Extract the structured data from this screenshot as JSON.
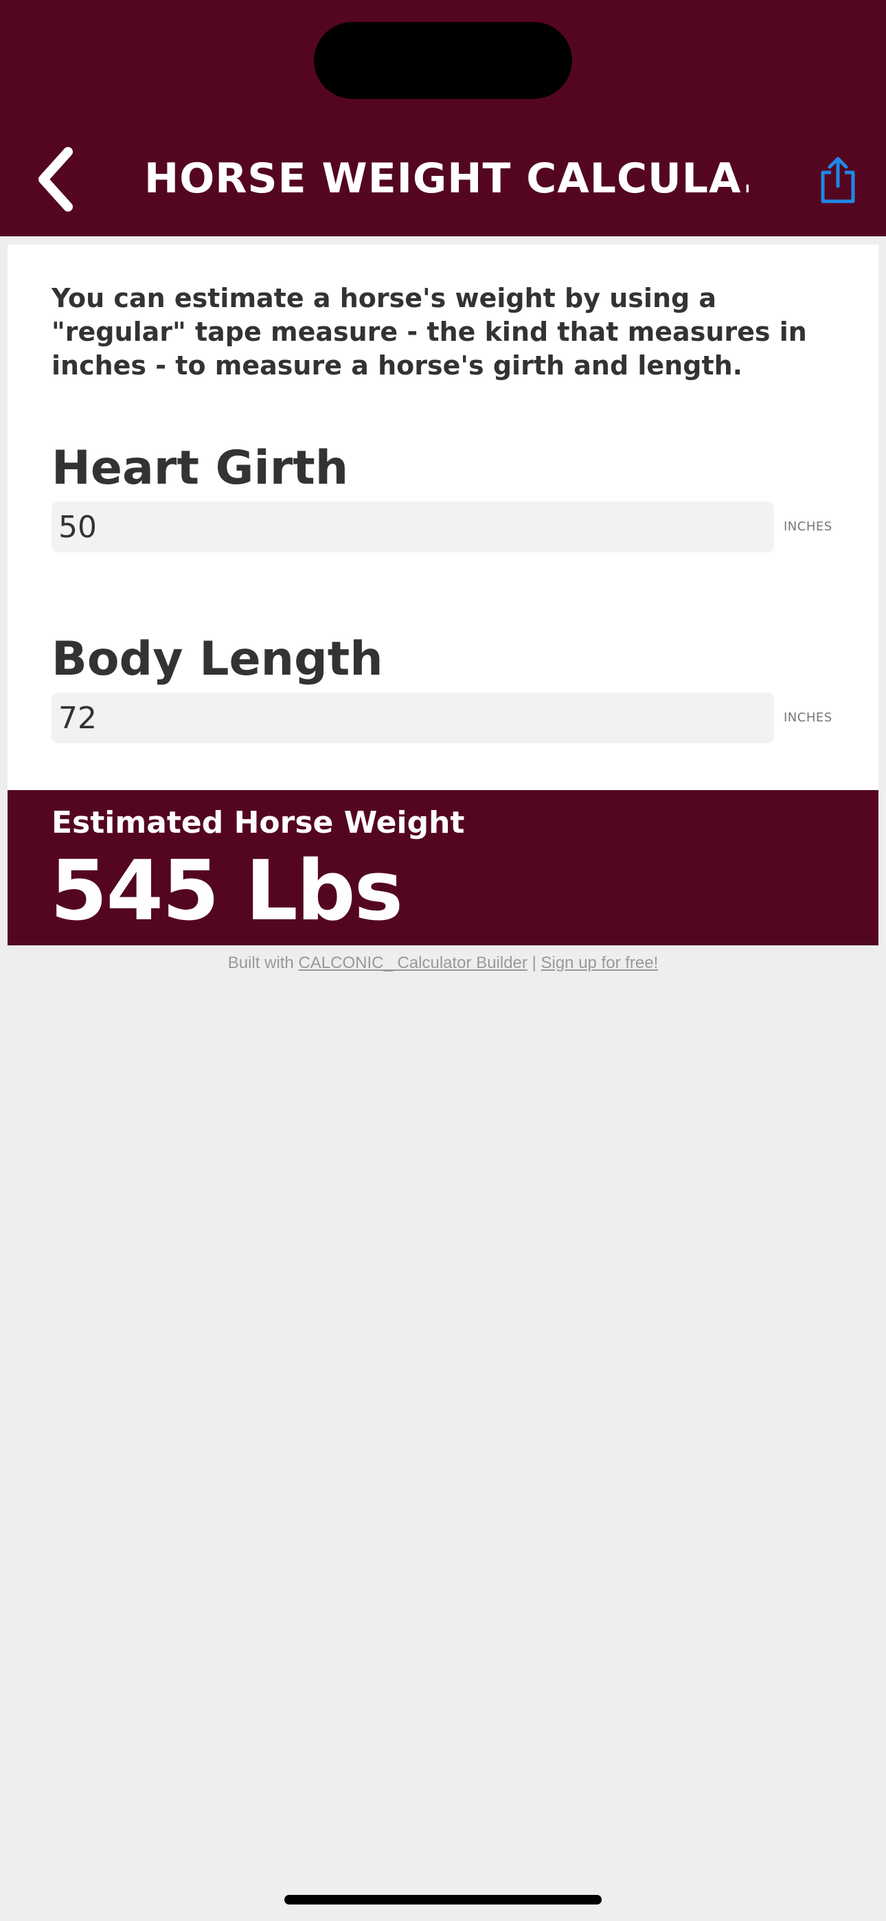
{
  "nav": {
    "title": "HORSE WEIGHT CALCULA...",
    "back_icon": "chevron-left-icon",
    "share_icon": "share-icon"
  },
  "colors": {
    "brand": "#540620",
    "accent_blue": "#1E88E5",
    "card_bg": "#FFFFFF",
    "page_bg": "#EEEEEE",
    "text": "#333333"
  },
  "intro": "You can estimate a horse's weight by using a \"regular\" tape measure - the kind that measures in inches - to measure a horse's girth and length.",
  "fields": [
    {
      "label": "Heart Girth",
      "value": "50",
      "unit": "INCHES"
    },
    {
      "label": "Body Length",
      "value": "72",
      "unit": "INCHES"
    }
  ],
  "result": {
    "label": "Estimated Horse Weight",
    "value": "545 Lbs"
  },
  "footer": {
    "prefix": "Built with ",
    "brand_link": "CALCONIC_ Calculator Builder",
    "separator": " | ",
    "signup_link": "Sign up for free!"
  }
}
